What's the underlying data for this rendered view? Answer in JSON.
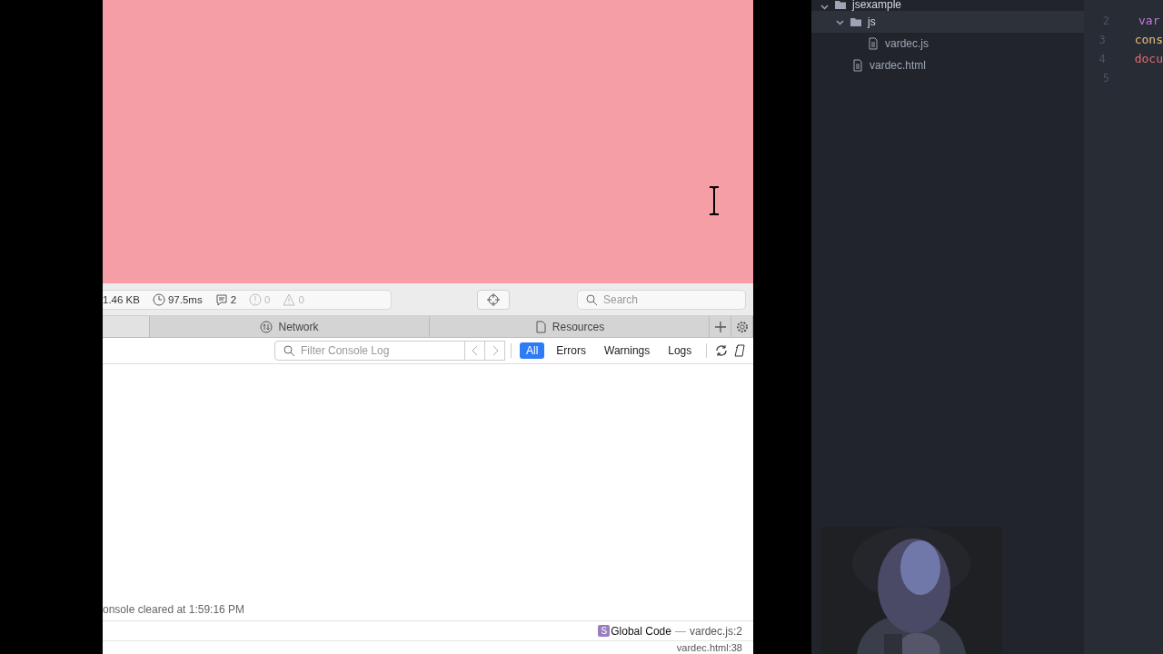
{
  "browser": {
    "toolbar": {
      "size": "1.46 KB",
      "time": "97.5ms",
      "messages": "2",
      "errors": "0",
      "warnings": "0",
      "search": {
        "placeholder": "Search"
      }
    },
    "tabs": [
      {
        "selected": true
      },
      {
        "label": "Network",
        "selected": false
      },
      {
        "label": "Resources",
        "selected": false
      }
    ],
    "console": {
      "filter": {
        "placeholder": "Filter Console Log"
      },
      "levels": [
        {
          "label": "All",
          "selected": true
        },
        {
          "label": "Errors",
          "selected": false
        },
        {
          "label": "Warnings",
          "selected": false
        },
        {
          "label": "Logs",
          "selected": false
        }
      ],
      "cleared": "onsole cleared at 1:59:16 PM",
      "trace": [
        {
          "badge": "S",
          "name": "Global Code",
          "dash": "—",
          "location": "vardec.js:2"
        },
        {
          "location": "vardec.html:38"
        }
      ]
    }
  },
  "editor": {
    "tree": [
      {
        "name": "jsexample",
        "kind": "folder",
        "expanded": true,
        "selected": false,
        "children": [
          {
            "name": "js",
            "kind": "folder",
            "expanded": true,
            "selected": true,
            "children": [
              {
                "name": "vardec.js",
                "kind": "file",
                "selected": false
              }
            ]
          },
          {
            "name": "vardec.html",
            "kind": "file",
            "selected": false
          }
        ]
      }
    ],
    "lines": [
      {
        "number": "2",
        "code": "var",
        "color": "#c678dd"
      },
      {
        "number": "3",
        "code": "cons",
        "color": "#e5c07b"
      },
      {
        "number": "4",
        "code": "docu",
        "color": "#e06c75"
      },
      {
        "number": "5"
      }
    ]
  }
}
